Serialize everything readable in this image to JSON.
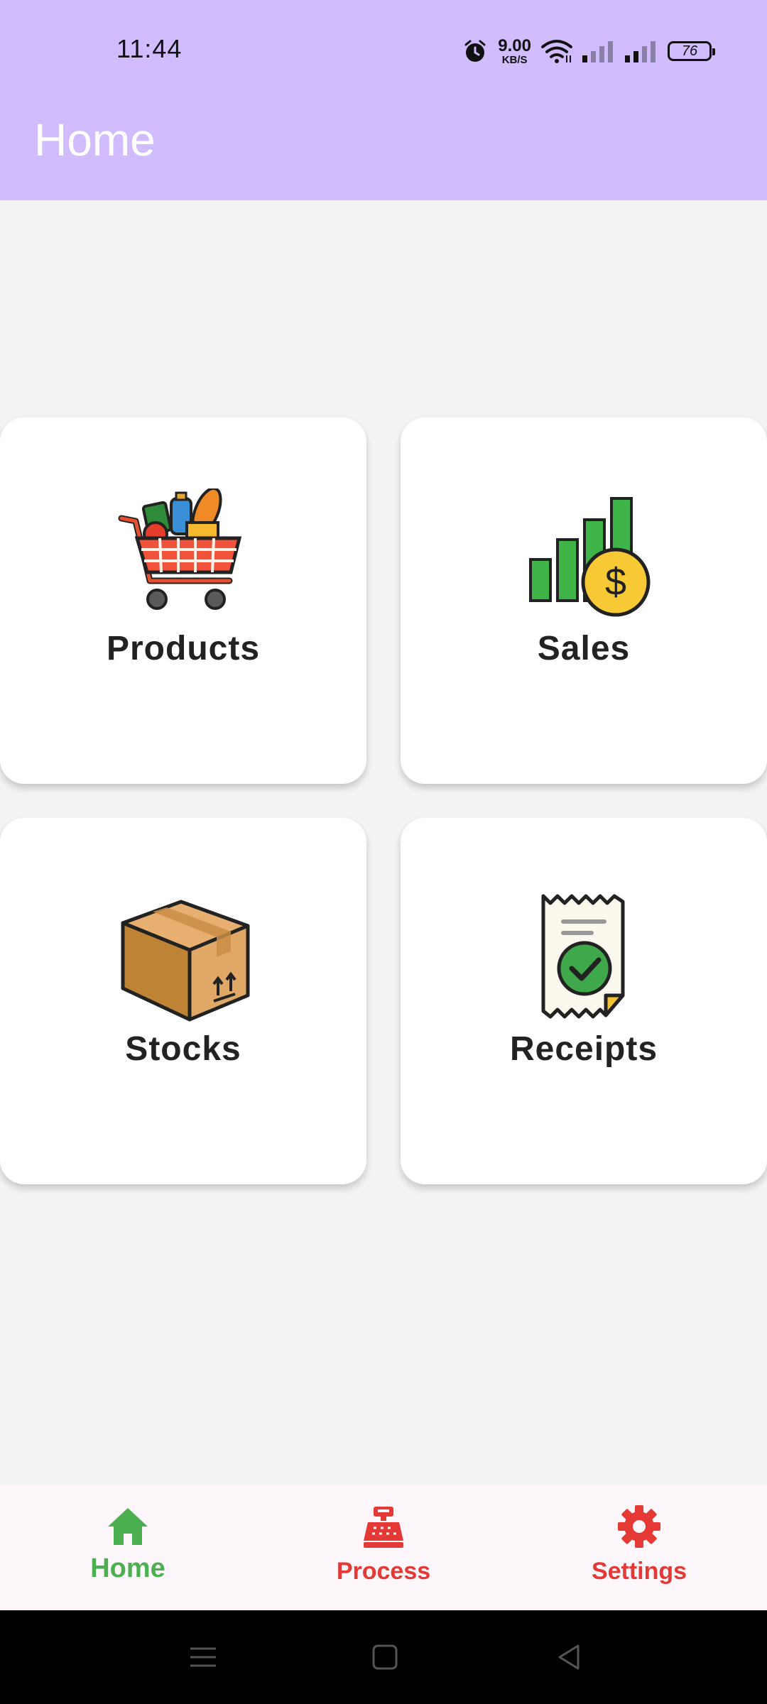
{
  "status_bar": {
    "time": "11:44",
    "net_speed_value": "9.00",
    "net_speed_unit": "KB/S",
    "battery": "76"
  },
  "app_bar": {
    "title": "Home"
  },
  "cards": [
    {
      "label": "Products",
      "icon": "shopping-cart-icon"
    },
    {
      "label": "Sales",
      "icon": "sales-chart-icon"
    },
    {
      "label": "Stocks",
      "icon": "box-icon"
    },
    {
      "label": "Receipts",
      "icon": "receipt-icon"
    }
  ],
  "bottom_nav": [
    {
      "label": "Home",
      "icon": "home-icon",
      "color": "#4caf50",
      "selected": true
    },
    {
      "label": "Process",
      "icon": "cash-register-icon",
      "color": "#e53935",
      "selected": false
    },
    {
      "label": "Settings",
      "icon": "gear-icon",
      "color": "#e53935",
      "selected": false
    }
  ],
  "colors": {
    "app_bar": "#d0bcfe",
    "background": "#f3f3f3",
    "active": "#4caf50",
    "inactive": "#e53935"
  }
}
